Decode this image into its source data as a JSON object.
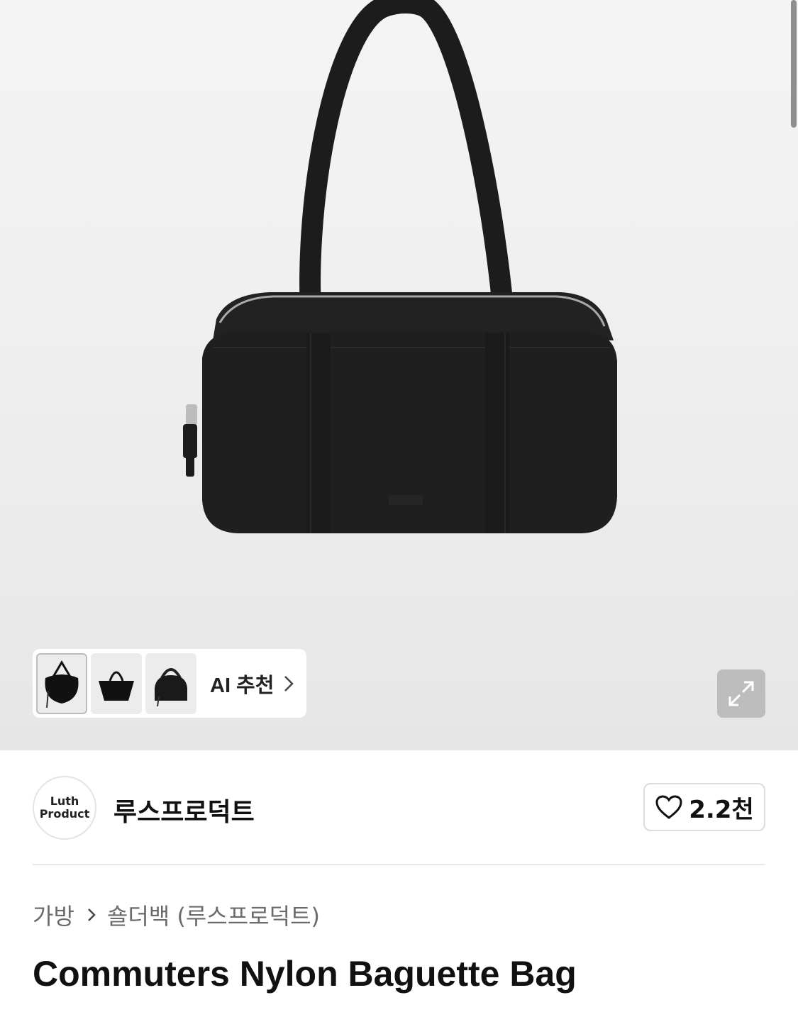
{
  "gallery": {
    "ai_recommend_label": "AI 추천",
    "thumbnails": [
      "hobo-bag-thumbnail",
      "tote-bag-thumbnail",
      "bowling-bag-thumbnail"
    ]
  },
  "brand": {
    "logo_text": "Luth\nProduct",
    "name": "루스프로덕트",
    "likes": "2.2천"
  },
  "breadcrumb": {
    "category": "가방",
    "subcategory": "숄더백 (루스프로덕트)"
  },
  "product": {
    "title": "Commuters Nylon Baguette Bag"
  },
  "colors": {
    "bag": "#1b1b1b",
    "hero_bg": "#efefef",
    "text_secondary": "#6b6b6b"
  }
}
